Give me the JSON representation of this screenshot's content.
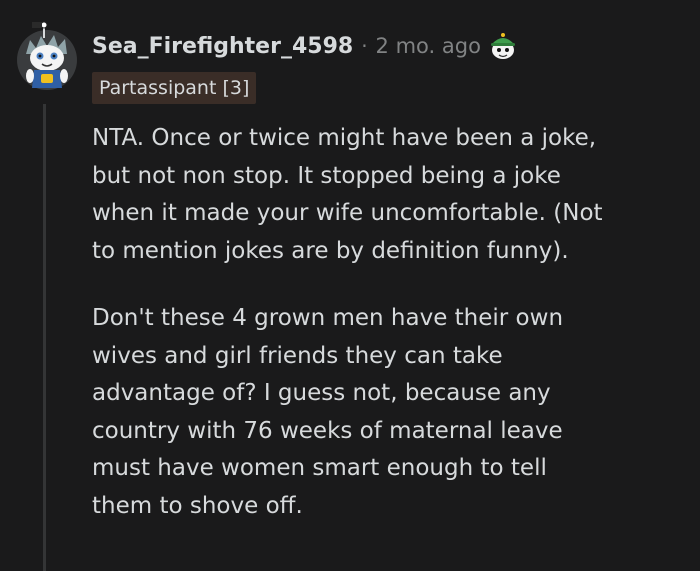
{
  "comment": {
    "username": "Sea_Firefighter_4598",
    "separator": "·",
    "time": "2 mo. ago",
    "flair": "Partassipant [3]",
    "avatar_icon": "snoo-avatar-icon",
    "award_icon": "snoo-award-icon",
    "paragraphs": [
      "NTA. Once or twice might have been a joke,\nbut not non stop. It stopped being a joke\nwhen it made your wife uncomfortable. (Not\nto mention jokes are by definition funny).",
      "Don't these 4 grown men have their own\nwives and girl friends they can take\nadvantage of? I guess not, because any\ncountry with 76 weeks of maternal leave\nmust have women smart enough to tell\nthem to shove off."
    ]
  },
  "colors": {
    "background": "#1a1a1b",
    "text": "#d7dadc",
    "meta": "#818384",
    "flair_bg": "#3a2d27",
    "thread_line": "#343536"
  }
}
